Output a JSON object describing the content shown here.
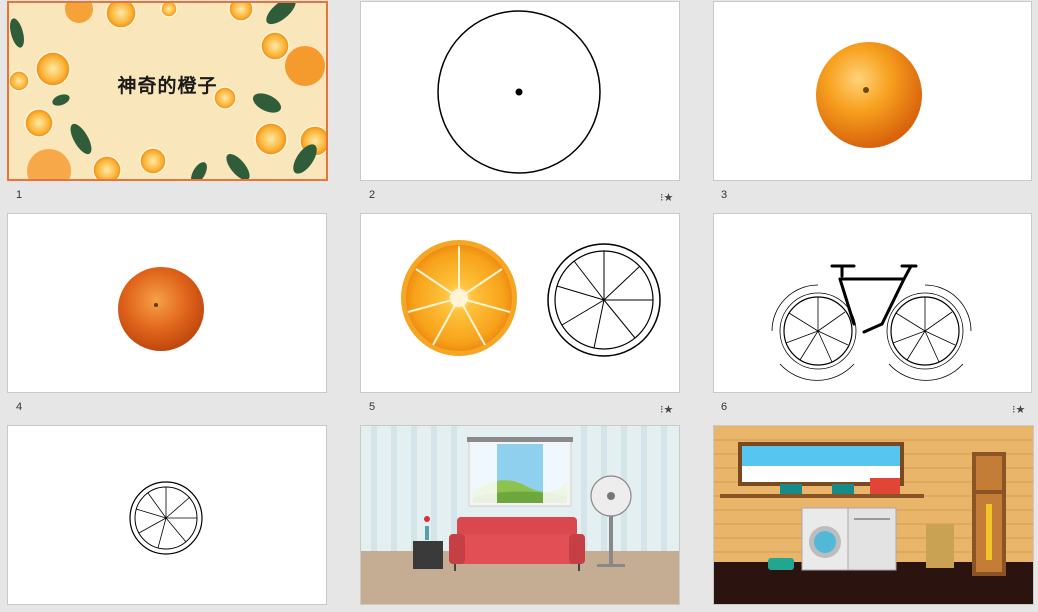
{
  "slides": [
    {
      "number": "1",
      "title": "神奇的橙子",
      "has_animation": false,
      "selected": true
    },
    {
      "number": "2",
      "has_animation": true
    },
    {
      "number": "3",
      "has_animation": false
    },
    {
      "number": "4",
      "has_animation": false
    },
    {
      "number": "5",
      "has_animation": true
    },
    {
      "number": "6",
      "has_animation": true
    },
    {
      "number": "",
      "has_animation": false
    },
    {
      "number": "",
      "has_animation": false
    },
    {
      "number": "",
      "has_animation": false
    }
  ],
  "animation_icon": "animation-star-icon",
  "animation_glyph": "⁝★",
  "colors": {
    "selection": "#e8743b",
    "background": "#e6e6e6",
    "orange": "#f39a1e"
  }
}
